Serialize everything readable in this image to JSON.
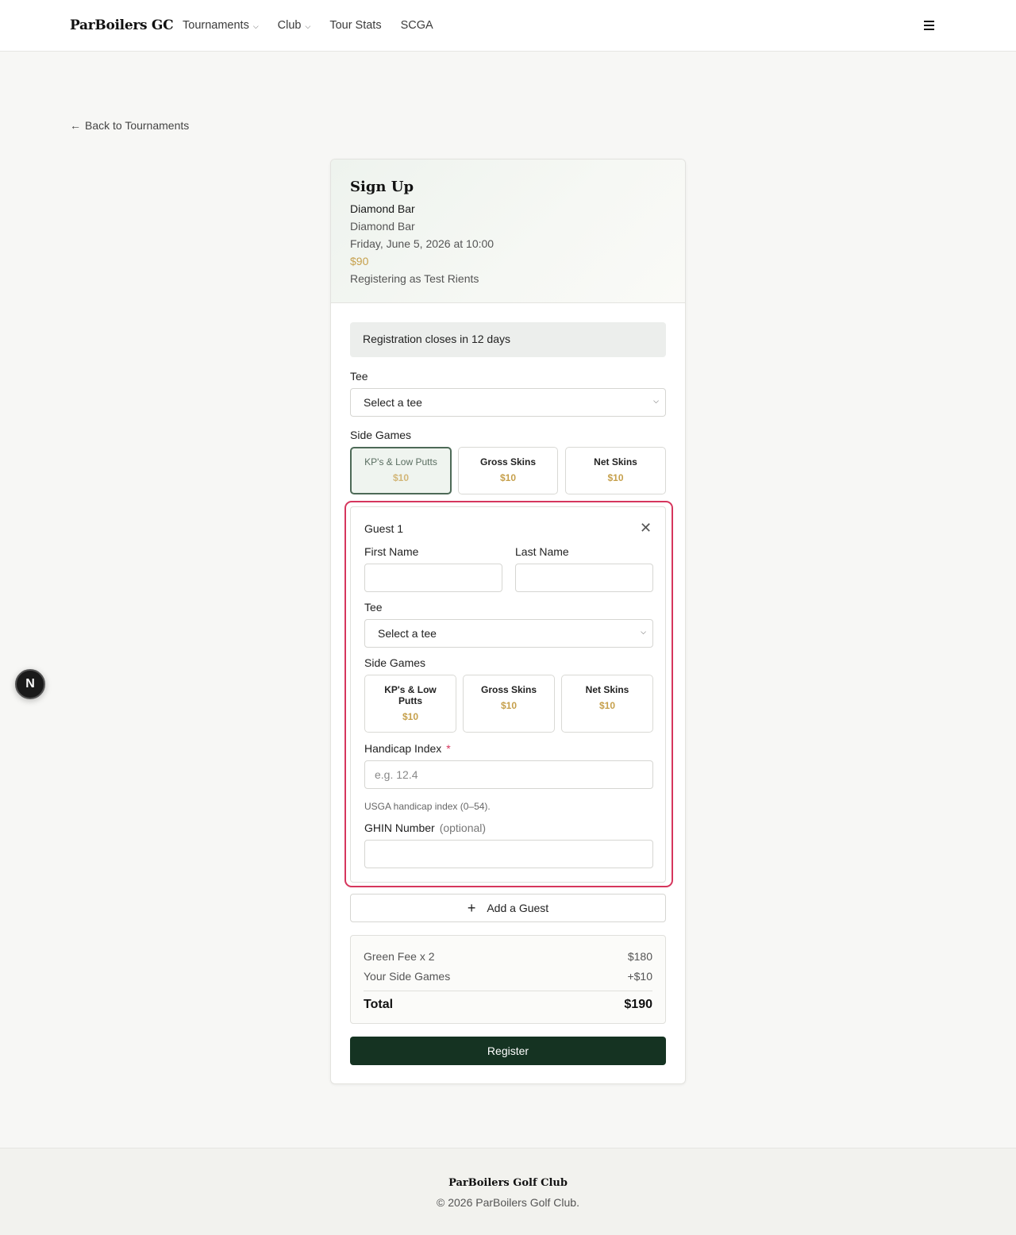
{
  "header": {
    "brand": "ParBoilers GC",
    "nav": [
      {
        "label": "Tournaments",
        "dropdown": true
      },
      {
        "label": "Club",
        "dropdown": true
      },
      {
        "label": "Tour Stats",
        "dropdown": false
      },
      {
        "label": "SCGA",
        "dropdown": false
      }
    ],
    "menu_icon": "hamburger-icon"
  },
  "back_link": "Back to Tournaments",
  "signup": {
    "title": "Sign Up",
    "event_name": "Diamond Bar",
    "course": "Diamond Bar",
    "datetime": "Friday, June 5, 2026 at 10:00",
    "price": "$90",
    "registering_as": "Registering as Test Rients"
  },
  "registration_notice": "Registration closes in 12 days",
  "tee": {
    "label": "Tee",
    "value": "Select a tee"
  },
  "side_games": {
    "label": "Side Games",
    "items": [
      {
        "name": "KP's & Low Putts",
        "price": "$10",
        "selected": true
      },
      {
        "name": "Gross Skins",
        "price": "$10",
        "selected": false
      },
      {
        "name": "Net Skins",
        "price": "$10",
        "selected": false
      }
    ]
  },
  "guest": {
    "title": "Guest 1",
    "first_name_label": "First Name",
    "first_name_value": "",
    "last_name_label": "Last Name",
    "last_name_value": "",
    "tee_label": "Tee",
    "tee_value": "Select a tee",
    "side_games_label": "Side Games",
    "side_games": [
      {
        "name": "KP's & Low Putts",
        "price": "$10"
      },
      {
        "name": "Gross Skins",
        "price": "$10"
      },
      {
        "name": "Net Skins",
        "price": "$10"
      }
    ],
    "handicap_label": "Handicap Index",
    "handicap_required": "*",
    "handicap_placeholder": "e.g. 12.4",
    "handicap_help": "USGA handicap index (0–54).",
    "ghin_label": "GHIN Number",
    "ghin_optional": "(optional)",
    "ghin_value": ""
  },
  "add_guest": "Add a Guest",
  "summary": {
    "green_fee_label": "Green Fee x 2",
    "green_fee_value": "$180",
    "side_games_label": "Your Side Games",
    "side_games_value": "+$10",
    "total_label": "Total",
    "total_value": "$190"
  },
  "register_button": "Register",
  "fab_letter": "N",
  "footer": {
    "title": "ParBoilers Golf Club",
    "copyright": "© 2026 ParBoilers Golf Club."
  },
  "colors": {
    "accent_green": "#153322",
    "price_gold": "#c6a04c",
    "highlight_border": "#d6365d"
  }
}
